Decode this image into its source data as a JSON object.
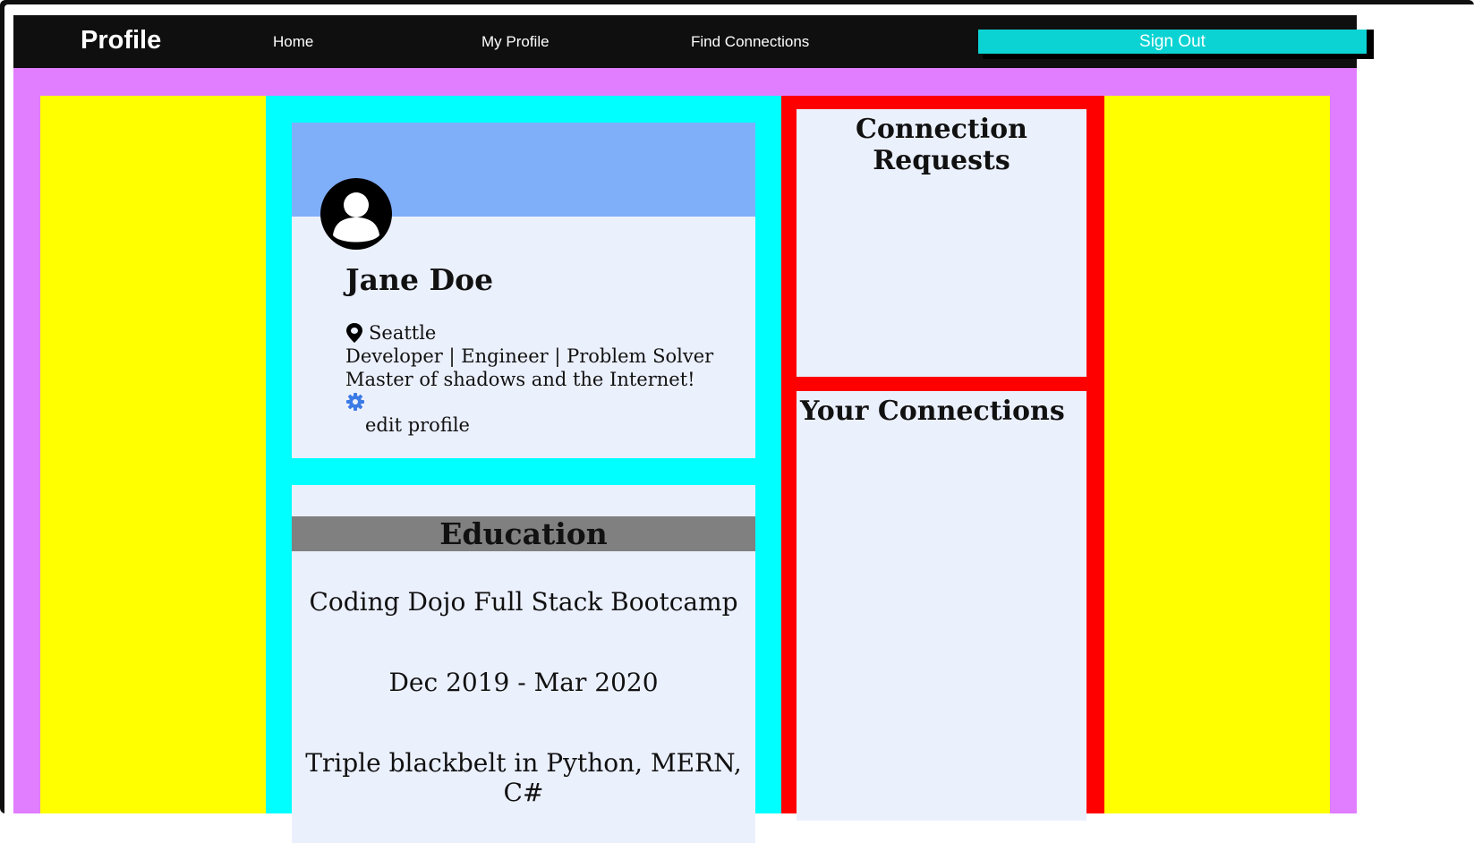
{
  "navbar": {
    "brand": "Profile",
    "links": [
      "Home",
      "My Profile",
      "Find Connections"
    ],
    "sign_out_label": "Sign Out"
  },
  "profile": {
    "name": "Jane Doe",
    "location": "Seattle",
    "headline": "Developer | Engineer | Problem Solver",
    "bio": "Master of shadows and the Internet!",
    "edit_label": "edit profile"
  },
  "education": {
    "title": "Education",
    "school": "Coding Dojo Full Stack Bootcamp",
    "dates": "Dec 2019 - Mar 2020",
    "description": "Triple blackbelt in Python, MERN, C#"
  },
  "sidebar": {
    "requests_title": "Connection Requests",
    "connections_title": "Your Connections"
  },
  "colors": {
    "navbar_bg": "#0f0f0f",
    "sign_out_bg": "#0cd3d3",
    "page_bg": "#e07eff",
    "outer_columns": "#ffff00",
    "middle_column": "#00ffff",
    "side_column": "#ff0000",
    "card_bg": "#ebf0fd",
    "banner": "#80affa",
    "education_header": "#808080",
    "gear": "#3b7be6"
  },
  "icons": {
    "avatar": "user-avatar-icon",
    "location": "map-pin-icon",
    "edit": "gear-icon"
  }
}
